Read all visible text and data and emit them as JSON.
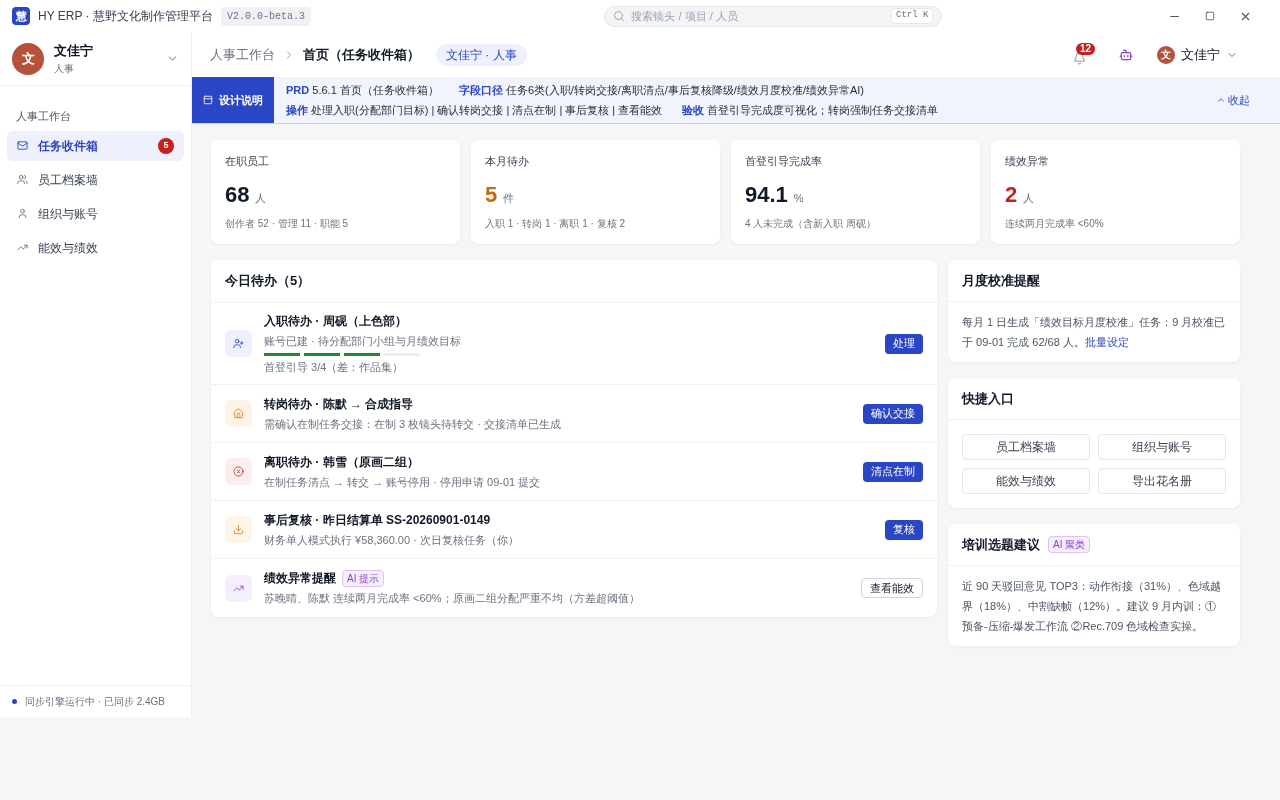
{
  "titlebar": {
    "logo": "慧",
    "app_name": "HY ERP · 慧野文化制作管理平台",
    "version": "V2.0.0-beta.3",
    "search_placeholder": "搜索镜头 / 项目 / 人员",
    "shortcut": "Ctrl K"
  },
  "sidebar": {
    "user": {
      "initial": "文",
      "name": "文佳宁",
      "role": "人事"
    },
    "section": "人事工作台",
    "items": [
      {
        "label": "任务收件箱",
        "kind": "inbox",
        "selected": true,
        "badge": "5"
      },
      {
        "label": "员工档案墙",
        "kind": "users",
        "selected": false
      },
      {
        "label": "组织与账号",
        "kind": "user",
        "selected": false
      },
      {
        "label": "能效与绩效",
        "kind": "trend",
        "selected": false
      }
    ],
    "status": "同步引擎运行中 · 已同步 2.4GB"
  },
  "header": {
    "breadcrumb": [
      "人事工作台",
      "首页（任务收件箱）"
    ],
    "role_tag": "文佳宁 · 人事",
    "notifications": "12",
    "user_initial": "文",
    "user_name": "文佳宁"
  },
  "design_note": {
    "label": "设计说明",
    "lines": [
      [
        {
          "key": "PRD",
          "text": "5.6.1 首页（任务收件箱）"
        },
        {
          "key": "字段口径",
          "text": "任务6类(入职/转岗交接/离职清点/事后复核降级/绩效月度校准/绩效异常AI)"
        }
      ],
      [
        {
          "key": "操作",
          "text": "处理入职(分配部门目标) | 确认转岗交接 | 清点在制 | 事后复核 | 查看能效"
        },
        {
          "key": "验收",
          "text": "首登引导完成度可视化；转岗强制任务交接清单"
        }
      ]
    ],
    "collapse": "收起"
  },
  "stats": [
    {
      "label": "在职员工",
      "value": "68",
      "unit": "人",
      "color": "#111827",
      "detail": "创作者 52 · 管理 11 · 职能 5"
    },
    {
      "label": "本月待办",
      "value": "5",
      "unit": "件",
      "color": "#c56a0c",
      "detail": "入职 1 · 转岗 1 · 离职 1 · 复核 2"
    },
    {
      "label": "首登引导完成率",
      "value": "94.1",
      "unit": "%",
      "color": "#111827",
      "detail": "4 人未完成（含新入职 周砚）"
    },
    {
      "label": "绩效异常",
      "value": "2",
      "unit": "人",
      "color": "#c81e1e",
      "detail": "连续两月完成率 <60%"
    }
  ],
  "todos": {
    "title": "今日待办（5）",
    "items": [
      {
        "kind": "onboard",
        "title": "入职待办 · 周砚（上色部）",
        "desc": "账号已建 · 待分配部门小组与月绩效目标",
        "progress": {
          "level": 0.75,
          "text": "首登引导 3/4（差：作品集）"
        },
        "action": "处理",
        "primary": true
      },
      {
        "kind": "transfer",
        "title": "转岗待办 · 陈默 → 合成指导",
        "desc": "需确认在制任务交接：在制 3 枚镜头待转交 · 交接清单已生成",
        "action": "确认交接",
        "primary": true
      },
      {
        "kind": "offboard",
        "title": "离职待办 · 韩雪（原画二组）",
        "desc": "在制任务清点 → 转交 → 账号停用 · 停用申请 09-01 提交",
        "action": "清点在制",
        "primary": true
      },
      {
        "kind": "review",
        "title": "事后复核 · 昨日结算单 SS-20260901-0149",
        "desc": "财务单人模式执行 ¥58,360.00 · 次日复核任务（你）",
        "action": "复核",
        "primary": true
      },
      {
        "kind": "ai",
        "title": "绩效异常提醒",
        "tag": "AI 提示",
        "desc": "苏晚晴、陈默 连续两月完成率 <60%；原画二组分配严重不均（方差超阈值）",
        "action": "查看能效",
        "primary": false
      }
    ]
  },
  "calibration": {
    "title": "月度校准提醒",
    "text": "每月 1 日生成「绩效目标月度校准」任务：9 月校准已于 09-01 完成 62/68 人。",
    "link": "批量设定"
  },
  "shortcuts": {
    "title": "快捷入口",
    "buttons": [
      "员工档案墙",
      "组织与账号",
      "能效与绩效",
      "导出花名册"
    ]
  },
  "training": {
    "title": "培训选题建议",
    "tag": "AI 聚类",
    "text": "近 90 天驳回意见 TOP3：动作衔接（31%）、色域越界（18%）、中割缺帧（12%）。建议 9 月内训：①预备-压缩-爆发工作流 ②Rec.709 色域检查实操。"
  }
}
